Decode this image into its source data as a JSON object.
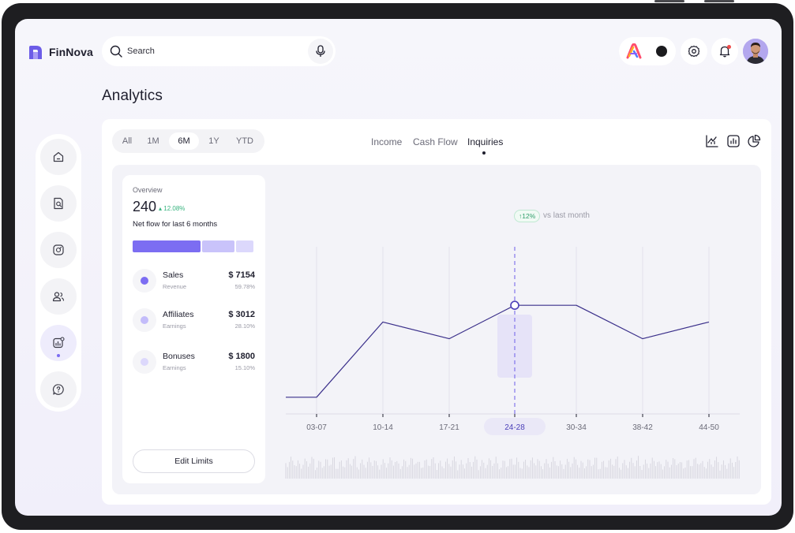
{
  "app": {
    "name": "FinNova"
  },
  "header": {
    "search_placeholder": "Search",
    "icons": [
      "search-icon",
      "microphone-icon",
      "brand-icon",
      "theme-toggle",
      "settings-icon",
      "bell-icon",
      "avatar"
    ]
  },
  "page": {
    "title": "Analytics"
  },
  "sidebar": {
    "items": [
      {
        "name": "home",
        "icon": "home-icon"
      },
      {
        "name": "search-docs",
        "icon": "document-search-icon"
      },
      {
        "name": "goals",
        "icon": "target-icon"
      },
      {
        "name": "users",
        "icon": "users-icon"
      },
      {
        "name": "analytics",
        "icon": "analytics-icon",
        "active": true
      },
      {
        "name": "help",
        "icon": "help-icon"
      }
    ]
  },
  "filters": {
    "periods": [
      "All",
      "1M",
      "6M",
      "1Y",
      "YTD"
    ],
    "active_period": "6M"
  },
  "tabs": {
    "items": [
      "Income",
      "Cash Flow",
      "Inquiries"
    ],
    "active": "Inquiries"
  },
  "chart_views": [
    "line-chart-icon",
    "bar-chart-icon",
    "pie-chart-icon"
  ],
  "overview": {
    "label": "Overview",
    "value": "240",
    "delta": "12.08%",
    "subtitle": "Net flow for last 6 months",
    "distribution": [
      {
        "label": "Sales",
        "fraction": 0.5978,
        "color": "#7c6df2"
      },
      {
        "label": "Affiliates",
        "fraction": 0.281,
        "color": "#c9c3fa"
      },
      {
        "label": "Bonuses",
        "fraction": 0.151,
        "color": "#dcd8fc"
      }
    ],
    "rows": [
      {
        "name": "Sales",
        "type": "Revenue",
        "amount": "$ 7154",
        "pct": "59.78%",
        "color": "#7c6df2"
      },
      {
        "name": "Affiliates",
        "type": "Earnings",
        "amount": "$ 3012",
        "pct": "28.10%",
        "color": "#c3bcfa"
      },
      {
        "name": "Bonuses",
        "type": "Earnings",
        "amount": "$ 1800",
        "pct": "15.10%",
        "color": "#dcd8fc"
      }
    ],
    "edit_button": "Edit Limits"
  },
  "highlight": {
    "badge": "12%",
    "label": "vs last month"
  },
  "chart_data": {
    "type": "line",
    "categories": [
      "03-07",
      "10-14",
      "17-21",
      "24-28",
      "30-34",
      "38-42",
      "44-50"
    ],
    "values": [
      1.0,
      5.5,
      4.5,
      6.5,
      6.5,
      4.5,
      5.5
    ],
    "leading_value": 1.0,
    "highlighted_category": "24-28",
    "ylim": [
      0,
      10
    ],
    "grid": true,
    "line_color": "#3a2f8a"
  },
  "colors": {
    "accent": "#7c6df2",
    "positive": "#36b37e"
  }
}
